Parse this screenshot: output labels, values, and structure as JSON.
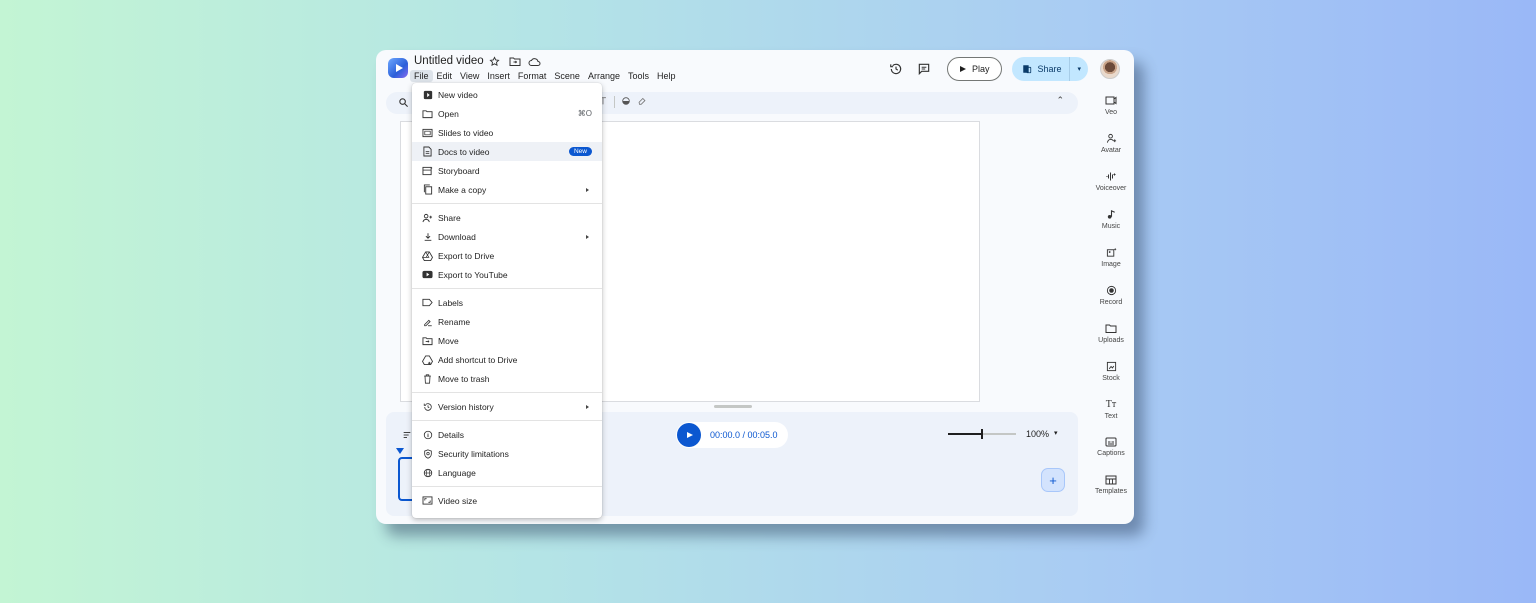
{
  "app": {
    "doc_title": "Untitled video",
    "menubar": [
      "File",
      "Edit",
      "View",
      "Insert",
      "Format",
      "Scene",
      "Arrange",
      "Tools",
      "Help"
    ],
    "active_menu": "File"
  },
  "header": {
    "play_label": "Play",
    "share_label": "Share"
  },
  "file_menu": {
    "items": [
      {
        "label": "New video",
        "icon": "new-video-icon"
      },
      {
        "label": "Open",
        "icon": "folder-icon",
        "shortcut": "⌘O"
      },
      {
        "label": "Slides to video",
        "icon": "slides-icon"
      },
      {
        "label": "Docs to video",
        "icon": "doc-icon",
        "badge": "New"
      },
      {
        "label": "Storyboard",
        "icon": "storyboard-icon"
      },
      {
        "label": "Make a copy",
        "icon": "copy-icon",
        "submenu": true
      },
      {
        "label": "Share",
        "icon": "person-add-icon"
      },
      {
        "label": "Download",
        "icon": "download-icon",
        "submenu": true
      },
      {
        "label": "Export to Drive",
        "icon": "drive-icon"
      },
      {
        "label": "Export to YouTube",
        "icon": "youtube-icon"
      },
      {
        "label": "Labels",
        "icon": "label-icon"
      },
      {
        "label": "Rename",
        "icon": "rename-icon"
      },
      {
        "label": "Move",
        "icon": "move-folder-icon"
      },
      {
        "label": "Add shortcut to Drive",
        "icon": "drive-shortcut-icon"
      },
      {
        "label": "Move to trash",
        "icon": "trash-icon"
      },
      {
        "label": "Version history",
        "icon": "history-icon",
        "submenu": true
      },
      {
        "label": "Details",
        "icon": "info-icon"
      },
      {
        "label": "Security limitations",
        "icon": "security-icon"
      },
      {
        "label": "Language",
        "icon": "globe-icon"
      },
      {
        "label": "Video size",
        "icon": "aspect-ratio-icon"
      }
    ]
  },
  "timeline": {
    "time_display": "00:00.0 / 00:05.0",
    "zoom_label": "100%",
    "zoom_level": 0.5
  },
  "right_rail": {
    "items": [
      "Veo",
      "Avatar",
      "Voiceover",
      "Music",
      "Image",
      "Record",
      "Uploads",
      "Stock",
      "Text",
      "Captions",
      "Templates"
    ]
  },
  "colors": {
    "accent": "#0b57d0",
    "share_bg": "#c2e7ff",
    "badge": "#0b57d0"
  }
}
